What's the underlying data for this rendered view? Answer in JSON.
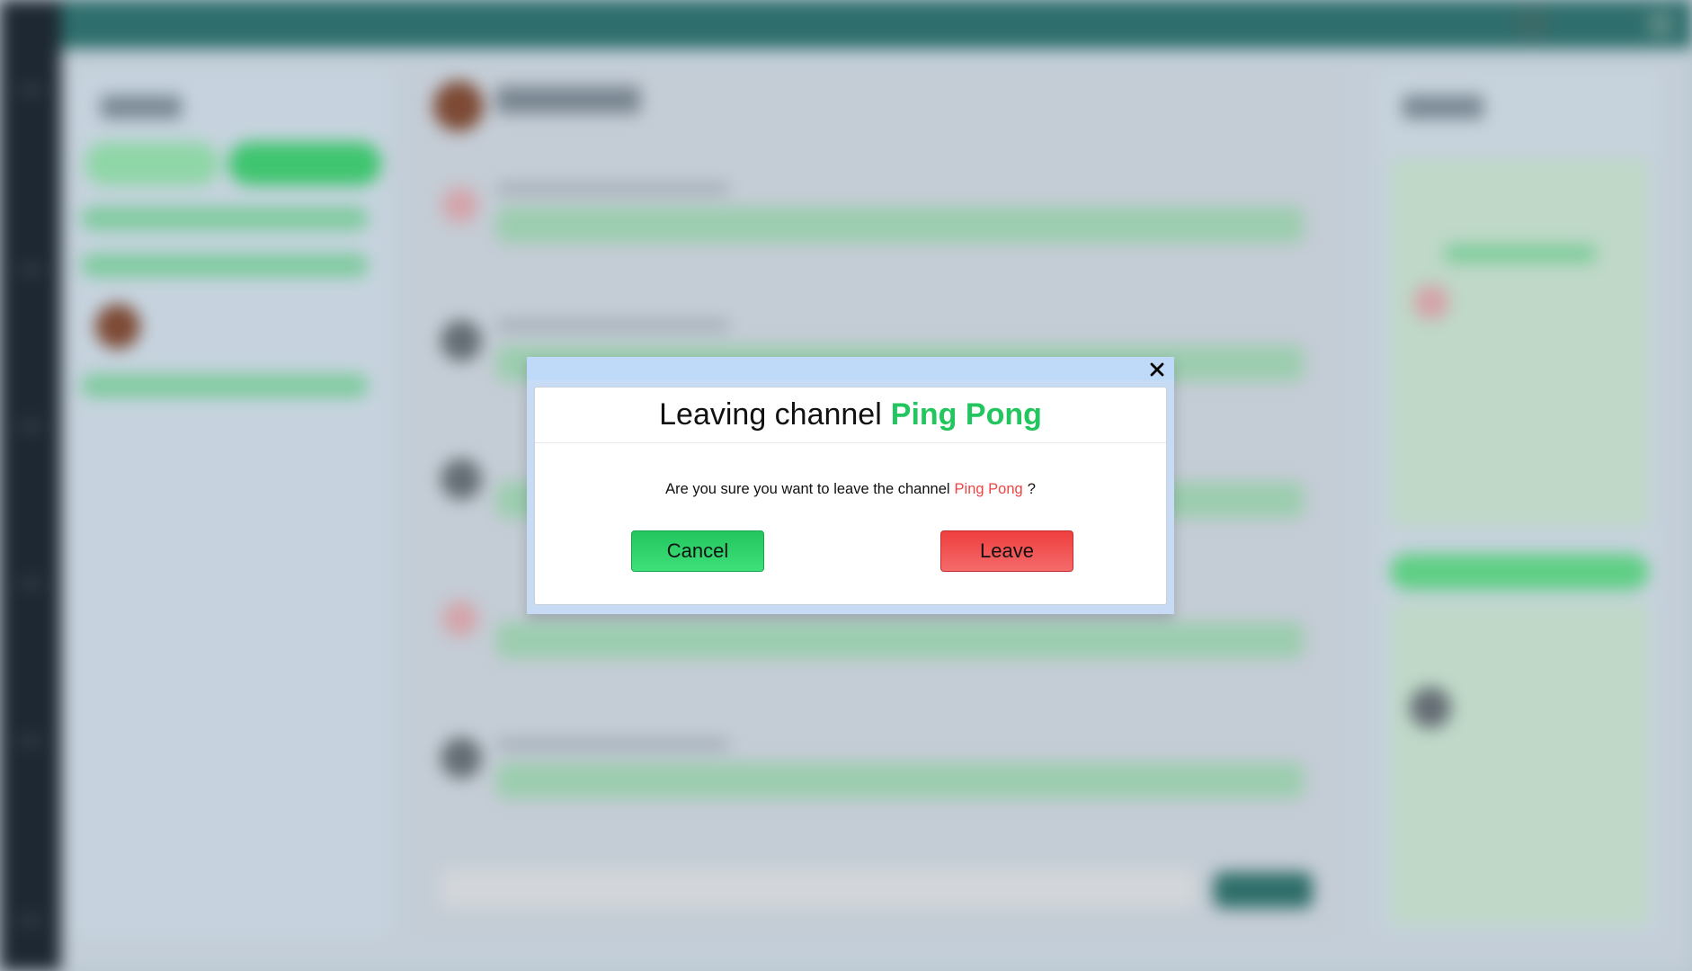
{
  "modal": {
    "title_prefix": "Leaving channel",
    "channel_name": "Ping Pong",
    "question_prefix": "Are you sure you want to leave the channel",
    "question_suffix": "?",
    "cancel_label": "Cancel",
    "leave_label": "Leave",
    "close_icon": "close-icon"
  },
  "colors": {
    "channel_name_title": "#22c55e",
    "channel_name_text": "#ef4444",
    "cancel_button": "#22c55e",
    "leave_button": "#ef4444",
    "modal_header": "#bfdaf8",
    "topbar": "#2e6e6c",
    "rail": "#1e2832"
  }
}
